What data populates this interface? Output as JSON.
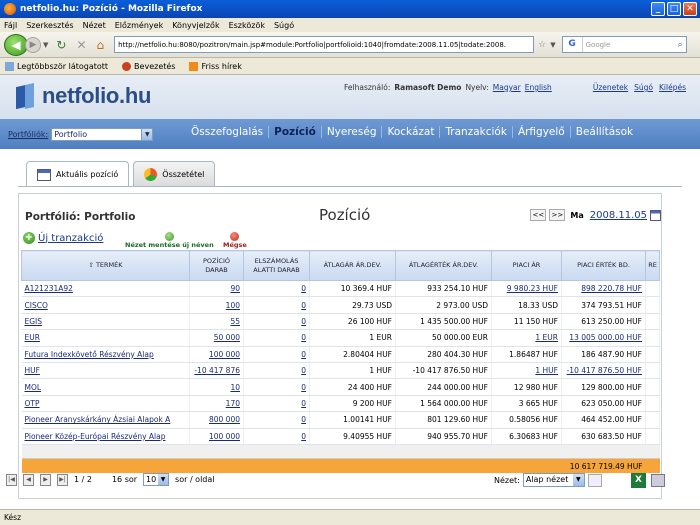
{
  "window": {
    "title": "netfolio.hu: Pozíció - Mozilla Firefox",
    "buttons": [
      "_",
      "□",
      "✕"
    ]
  },
  "menu": [
    "Fájl",
    "Szerkesztés",
    "Nézet",
    "Előzmények",
    "Könyvjelzők",
    "Eszközök",
    "Súgó"
  ],
  "nav": {
    "url": "http://netfolio.hu:8080/pozitron/main.jsp#module:Portfolio|portfolioid:1040|fromdate:2008.11.05|todate:2008.",
    "search_placeholder": "Google"
  },
  "bookmarks": [
    "Legtöbbször látogatott",
    "Bevezetés",
    "Friss hírek"
  ],
  "site": {
    "logo": "netfolio.hu",
    "user_label": "Felhasználó:",
    "user_name": "Ramasoft Demo",
    "lang_label": "Nyelv:",
    "lang_hu": "Magyar",
    "lang_en": "English",
    "links": [
      "Üzenetek",
      "Súgó",
      "Kilépés"
    ],
    "portfolio_label": "Portfóliók:",
    "portfolio_value": "Portfolio",
    "tabs": [
      "Összefoglalás",
      "Pozíció",
      "Nyereség",
      "Kockázat",
      "Tranzakciók",
      "Árfigyelő",
      "Beállítások"
    ],
    "active_tab": "Pozíció"
  },
  "subtabs": [
    "Aktuális pozíció",
    "Összetétel"
  ],
  "panel": {
    "title": "Portfólió: Portfolio",
    "center_title": "Pozíció",
    "prev": "<<",
    "next": ">>",
    "today": "Ma",
    "date": "2008.11.05",
    "new_tx": "Új tranzakció",
    "view_save": "Nézet mentése új néven",
    "view_cancel": "Mégse"
  },
  "table": {
    "headers": [
      "⇧ TERMÉK",
      "POZÍCIÓ DARAB",
      "ELSZÁMOLÁS ALATTI DARAB",
      "ÁTLAGÁR ÁR.DEV.",
      "ÁTLAGÉRTÉK ÁR.DEV.",
      "PIACI ÁR",
      "PIACI ÉRTÉK BD.",
      "RE"
    ],
    "rows": [
      [
        "A121231A92",
        "90",
        "0",
        "10 369.4 HUF",
        "933 254.10 HUF",
        "9 980.23 HUF",
        "898 220.78 HUF"
      ],
      [
        "CISCO",
        "100",
        "0",
        "29.73 USD",
        "2 973.00 USD",
        "18.33 USD",
        "374 793.51 HUF"
      ],
      [
        "EGIS",
        "55",
        "0",
        "26 100 HUF",
        "1 435 500.00 HUF",
        "11 150 HUF",
        "613 250.00 HUF"
      ],
      [
        "EUR",
        "50 000",
        "0",
        "1 EUR",
        "50 000.00 EUR",
        "1 EUR",
        "13 005 000.00 HUF"
      ],
      [
        "Futura Indexkövető Részvény Alap",
        "100 000",
        "0",
        "2.80404 HUF",
        "280 404.30 HUF",
        "1.86487 HUF",
        "186 487.90 HUF"
      ],
      [
        "HUF",
        "-10 417 876",
        "0",
        "1 HUF",
        "-10 417 876.50 HUF",
        "1 HUF",
        "-10 417 876.50 HUF"
      ],
      [
        "MOL",
        "10",
        "0",
        "24 400 HUF",
        "244 000.00 HUF",
        "12 980 HUF",
        "129 800.00 HUF"
      ],
      [
        "OTP",
        "170",
        "0",
        "9 200 HUF",
        "1 564 000.00 HUF",
        "3 665 HUF",
        "623 050.00 HUF"
      ],
      [
        "Pioneer Aranyskárkány Ázsiai Alapok A",
        "800 000",
        "0",
        "1.00141 HUF",
        "801 129.60 HUF",
        "0.58056 HUF",
        "464 452.00 HUF"
      ],
      [
        "Pioneer Közép-Európai Részvény Alap",
        "100 000",
        "0",
        "9.40955 HUF",
        "940 955.70 HUF",
        "6.30683 HUF",
        "630 683.50 HUF"
      ]
    ],
    "total": "10 617 719.49 HUF"
  },
  "pager": {
    "page": "1 / 2",
    "rows": "16 sor",
    "per_page": "10",
    "per_page_label": "sor / oldal",
    "view_label": "Nézet:",
    "view_value": "Alap nézet"
  },
  "status": "Kész"
}
